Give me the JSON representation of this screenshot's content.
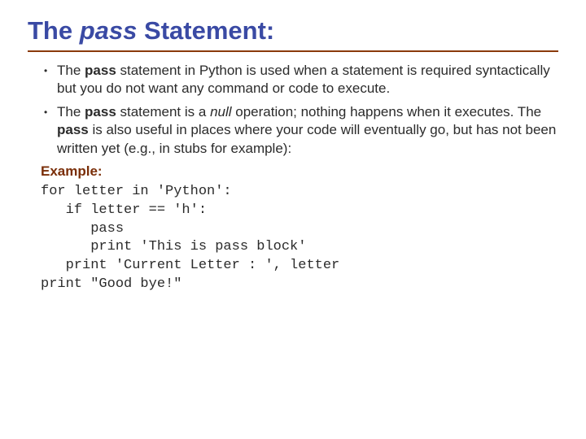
{
  "title_parts": {
    "pre": "The ",
    "kw": "pass",
    "post": " Statement:"
  },
  "bullet1": {
    "pre": "The ",
    "kw": "pass",
    "post": " statement in Python is used when a statement is required syntactically but you do not want any command or code to execute."
  },
  "bullet2": {
    "pre": "The ",
    "kw1": "pass",
    "mid1": " statement is a ",
    "null_word": "null",
    "mid2": " operation; nothing happens when it executes. The ",
    "kw2": "pass",
    "post": " is also useful in places where your code will eventually go, but has not been written yet (e.g., in stubs for example):"
  },
  "example_label": "Example:",
  "code_lines": {
    "l1": "for letter in 'Python':",
    "l2": "   if letter == 'h':",
    "l3": "      pass",
    "l4": "      print 'This is pass block'",
    "l5": "   print 'Current Letter : ', letter",
    "l6": "print \"Good bye!\""
  }
}
